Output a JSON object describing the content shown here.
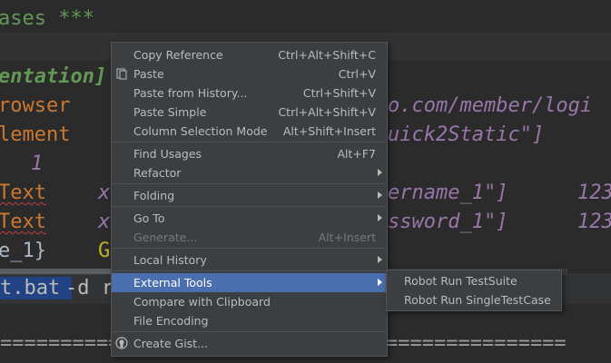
{
  "editor": {
    "line0": "ases ***",
    "line1": "entation]",
    "line2_kw": "rowser",
    "line2_url": "o.com/member/logi",
    "line3_kw": "lement",
    "line3_str": "uick2Static\"]",
    "line4_num": "1",
    "line5_kw": "Text",
    "line5_x": "x",
    "line5_str": "ername_1\"]",
    "line5_num": "123",
    "line6_kw": "Text",
    "line6_x": "x",
    "line6_str": "ssword_1\"]",
    "line6_num": "123",
    "line7_a": "e_1}",
    "line7_b": "G"
  },
  "terminal": {
    "selected": "t.bat ",
    "rest": "-d r",
    "rule_left": "===========",
    "rule_right": "==============="
  },
  "menu": {
    "items": [
      {
        "label": "Copy Reference",
        "shortcut": "Ctrl+Alt+Shift+C"
      },
      {
        "label": "Paste",
        "shortcut": "Ctrl+V"
      },
      {
        "label": "Paste from History...",
        "shortcut": "Ctrl+Shift+V"
      },
      {
        "label": "Paste Simple",
        "shortcut": "Ctrl+Alt+Shift+V"
      },
      {
        "label": "Column Selection Mode",
        "shortcut": "Alt+Shift+Insert"
      },
      {
        "label": "Find Usages",
        "shortcut": "Alt+F7"
      },
      {
        "label": "Refactor",
        "shortcut": ""
      },
      {
        "label": "Folding",
        "shortcut": ""
      },
      {
        "label": "Go To",
        "shortcut": ""
      },
      {
        "label": "Generate...",
        "shortcut": "Alt+Insert"
      },
      {
        "label": "Local History",
        "shortcut": ""
      },
      {
        "label": "External Tools",
        "shortcut": ""
      },
      {
        "label": "Compare with Clipboard",
        "shortcut": ""
      },
      {
        "label": "File Encoding",
        "shortcut": ""
      },
      {
        "label": "Create Gist...",
        "shortcut": ""
      }
    ]
  },
  "submenu": {
    "items": [
      {
        "label": "Robot Run TestSuite"
      },
      {
        "label": "Robot Run SingleTestCase"
      }
    ]
  },
  "colors": {
    "menu_bg": "#3c3f41",
    "highlight": "#4b6eaf",
    "selection": "#214283"
  }
}
